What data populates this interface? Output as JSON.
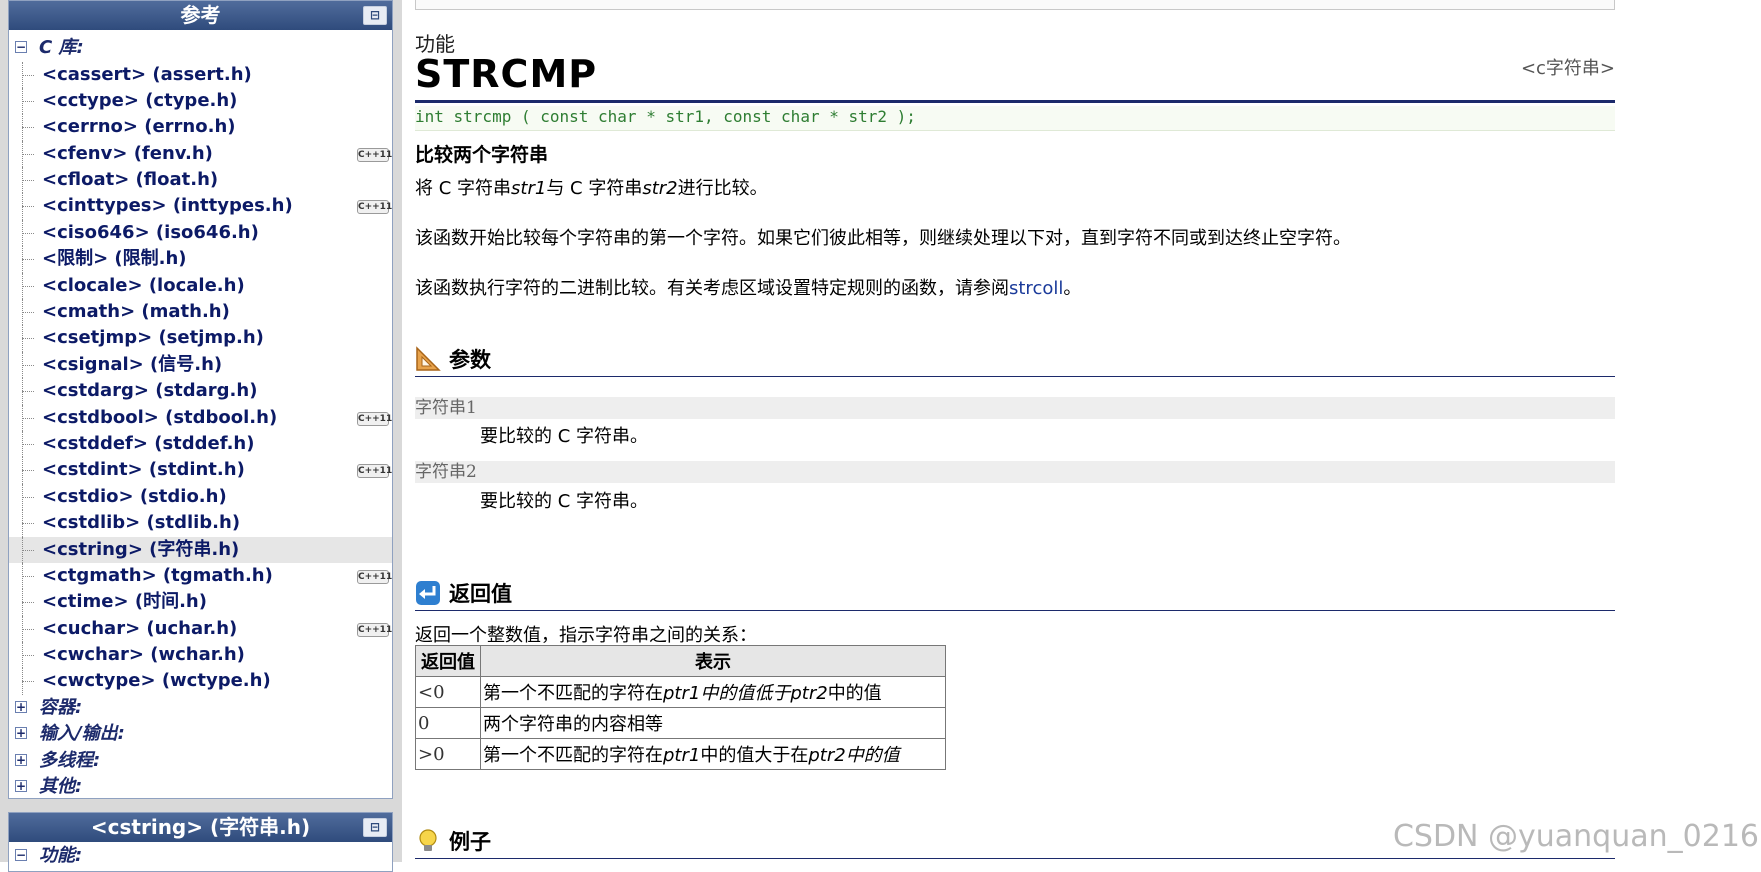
{
  "sidebar": {
    "reference_panel": {
      "title": "参考",
      "book_icon": "book-icon",
      "category_c": "C 库:",
      "items": [
        {
          "label": "<cassert> (assert.h)",
          "cpp": false
        },
        {
          "label": "<cctype> (ctype.h)",
          "cpp": false
        },
        {
          "label": "<cerrno> (errno.h)",
          "cpp": false
        },
        {
          "label": "<cfenv> (fenv.h)",
          "cpp": true
        },
        {
          "label": "<cfloat> (float.h)",
          "cpp": false
        },
        {
          "label": "<cinttypes> (inttypes.h)",
          "cpp": true
        },
        {
          "label": "<ciso646> (iso646.h)",
          "cpp": false
        },
        {
          "label": "<限制> (限制.h)",
          "cpp": false
        },
        {
          "label": "<clocale> (locale.h)",
          "cpp": false
        },
        {
          "label": "<cmath> (math.h)",
          "cpp": false
        },
        {
          "label": "<csetjmp> (setjmp.h)",
          "cpp": false
        },
        {
          "label": "<csignal> (信号.h)",
          "cpp": false
        },
        {
          "label": "<cstdarg> (stdarg.h)",
          "cpp": false
        },
        {
          "label": "<cstdbool> (stdbool.h)",
          "cpp": true
        },
        {
          "label": "<cstddef> (stddef.h)",
          "cpp": false
        },
        {
          "label": "<cstdint> (stdint.h)",
          "cpp": true
        },
        {
          "label": "<cstdio> (stdio.h)",
          "cpp": false
        },
        {
          "label": "<cstdlib> (stdlib.h)",
          "cpp": false
        },
        {
          "label": "<cstring> (字符串.h)",
          "cpp": false,
          "active": true
        },
        {
          "label": "<ctgmath> (tgmath.h)",
          "cpp": true
        },
        {
          "label": "<ctime> (时间.h)",
          "cpp": false
        },
        {
          "label": "<cuchar> (uchar.h)",
          "cpp": true
        },
        {
          "label": "<cwchar> (wchar.h)",
          "cpp": false
        },
        {
          "label": "<cwctype> (wctype.h)",
          "cpp": false
        }
      ],
      "cpp_badge": "C++11",
      "collapsed_categories": [
        "容器:",
        "输入/输出:",
        "多线程:",
        "其他:"
      ]
    },
    "cstring_panel": {
      "title": "<cstring> (字符串.h)",
      "first_category": "功能:"
    }
  },
  "main": {
    "kicker": "功能",
    "function_name": "STRCMP",
    "header_tag": "<c字符串>",
    "prototype": "int strcmp ( const char * str1, const char * str2 );",
    "summary": "比较两个字符串",
    "desc1_prefix": "将 C 字符串",
    "desc1_str1": "str1",
    "desc1_mid": "与 C 字符串",
    "desc1_str2": "str2",
    "desc1_suffix": "进行比较。",
    "desc2": "该函数开始比较每个字符串的第一个字符。如果它们彼此相等，则继续处理以下对，直到字符不同或到达终止空字符。",
    "desc3_prefix": "该函数执行字符的二进制比较。有关考虑区域设置特定规则的函数，请参阅",
    "desc3_link": "strcoll",
    "desc3_suffix": "。",
    "params_heading": "参数",
    "params": [
      {
        "name": "字符串1",
        "desc": "要比较的 C 字符串。"
      },
      {
        "name": "字符串2",
        "desc": "要比较的 C 字符串。"
      }
    ],
    "return_heading": "返回值",
    "return_intro": "返回一个整数值，指示字符串之间的关系：",
    "return_table": {
      "headers": [
        "返回值",
        "表示"
      ],
      "rows": [
        {
          "value": "<0",
          "pre": "第一个不匹配的字符在",
          "a": "ptr1",
          "mid": "中的值低于",
          "b": "ptr2",
          "post": "中的值"
        },
        {
          "value": "0",
          "pre": "两个字符串的内容相等",
          "a": "",
          "mid": "",
          "b": "",
          "post": ""
        },
        {
          "value": ">0",
          "pre": "第一个不匹配的字符在",
          "a": "ptr1",
          "mid": "中的值大于在",
          "b": "ptr2",
          "post": "中的值"
        }
      ]
    },
    "example_heading": "例子"
  },
  "watermark": "CSDN @yuanquan_0216",
  "colors": {
    "sidebar_bg": "#d9d9d9",
    "panel_header": "#2f4b7c",
    "nav_text": "#0c1a66",
    "rule": "#1c2a6b",
    "prototype_text": "#2e7d32",
    "link": "#1a3a9a"
  }
}
